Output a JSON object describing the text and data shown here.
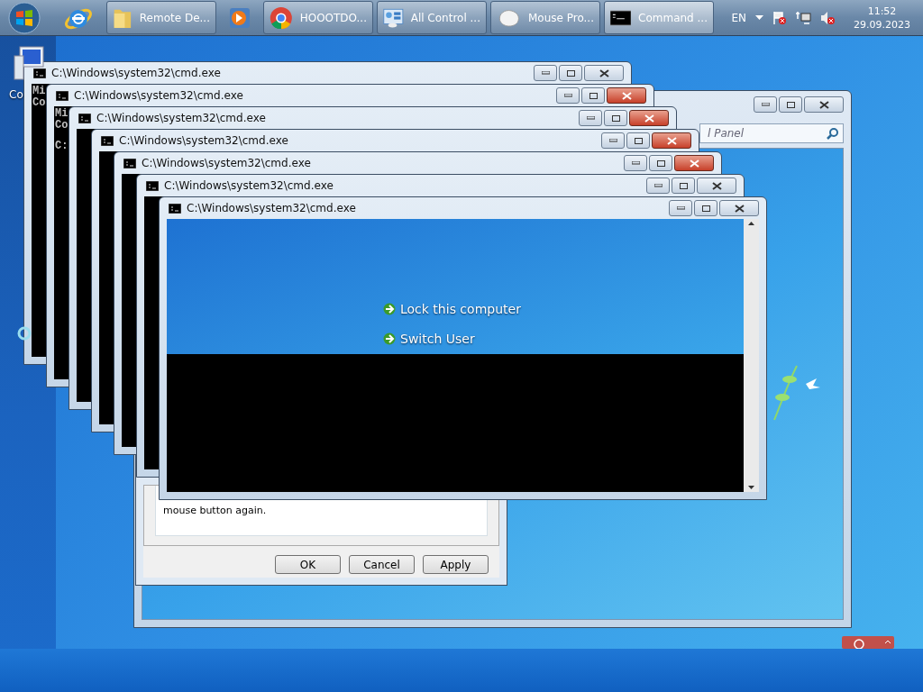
{
  "taskbar": {
    "items": [
      {
        "kind": "browser",
        "selected": false
      },
      {
        "kind": "folder",
        "label": "Remote De...",
        "selected": false
      },
      {
        "kind": "media",
        "selected": false
      },
      {
        "kind": "chrome",
        "label": "HOOOTDO...",
        "selected": false
      },
      {
        "kind": "control",
        "label": "All Control ...",
        "selected": false
      },
      {
        "kind": "mouse",
        "label": "Mouse Pro...",
        "selected": false
      },
      {
        "kind": "console",
        "label": "Command ...",
        "selected": true
      }
    ],
    "language": "EN",
    "time": "11:52",
    "date": "29.09.2023"
  },
  "desktop_icon": {
    "label": "Co"
  },
  "control_panel": {
    "search": {
      "placeholder": "l Panel"
    }
  },
  "mouse_properties": {
    "text": "mouse button again.",
    "buttons": [
      "OK",
      "Cancel",
      "Apply"
    ]
  },
  "cmd_windows": [
    {
      "title": "C:\\Windows\\system32\\cmd.exe",
      "active": false,
      "console_lines": [
        "Mi",
        "Co"
      ]
    },
    {
      "title": "C:\\Windows\\system32\\cmd.exe",
      "active": true,
      "console_lines": [
        "Mi",
        "Co",
        "C:"
      ]
    },
    {
      "title": "C:\\Windows\\system32\\cmd.exe",
      "active": true
    },
    {
      "title": "C:\\Windows\\system32\\cmd.exe",
      "active": true
    },
    {
      "title": "C:\\Windows\\system32\\cmd.exe",
      "active": true
    },
    {
      "title": "C:\\Windows\\system32\\cmd.exe",
      "active": false
    },
    {
      "title": "C:\\Windows\\system32\\cmd.exe",
      "active": false,
      "screen_links": [
        "Lock this computer",
        "Switch User"
      ]
    }
  ]
}
